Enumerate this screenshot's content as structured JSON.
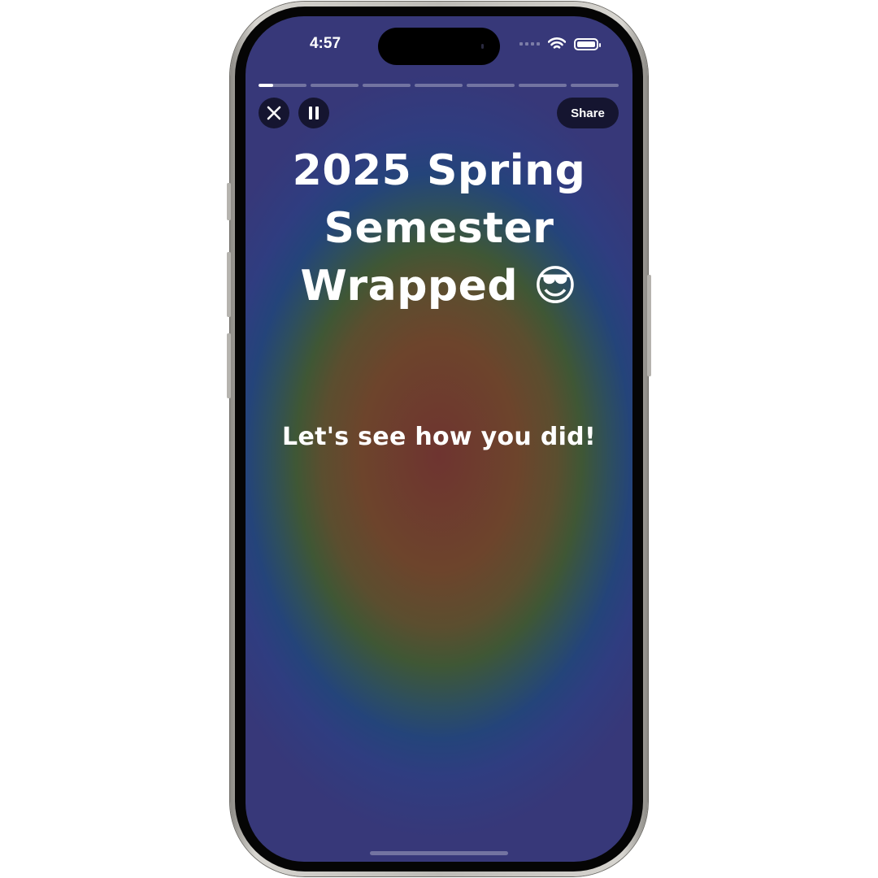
{
  "status_bar": {
    "time": "4:57",
    "icons": [
      "cellular-signal-icon",
      "wifi-icon",
      "battery-icon"
    ]
  },
  "story": {
    "total_segments": 7,
    "current_segment": 1,
    "current_segment_progress": 0.3
  },
  "controls": {
    "close_icon": "close-icon",
    "pause_icon": "pause-icon",
    "share_label": "Share"
  },
  "slide": {
    "title_line1": "2025 Spring",
    "title_line2": "Semester",
    "title_line3": "Wrapped 😎",
    "subtitle": "Let's see how you did!"
  },
  "colors": {
    "center_glow": "#6e3430",
    "mid_ring": "#3f5735",
    "outer_ring": "#24447a",
    "edge": "#373879",
    "button_bg": "#0f0f23",
    "text": "#ffffff"
  }
}
